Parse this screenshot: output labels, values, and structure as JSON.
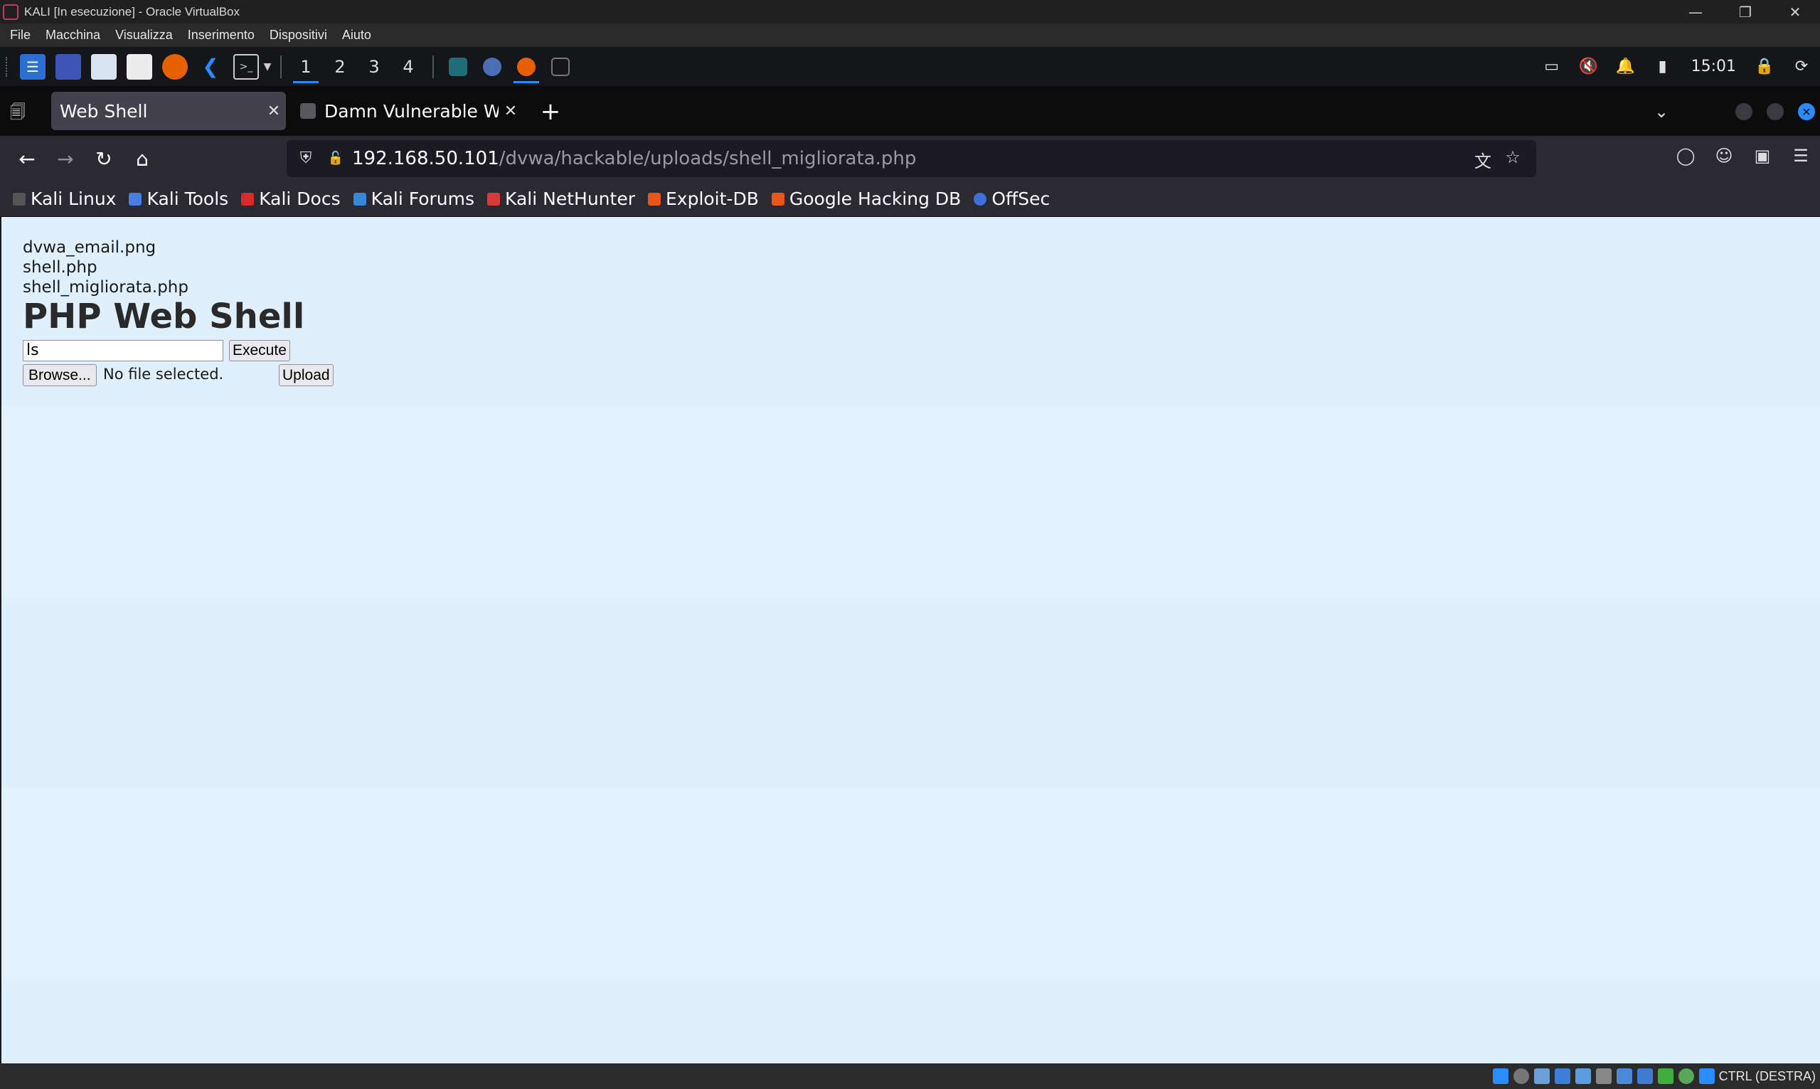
{
  "vbox": {
    "title": "KALI [In esecuzione] - Oracle VirtualBox",
    "menu": [
      "File",
      "Macchina",
      "Visualizza",
      "Inserimento",
      "Dispositivi",
      "Aiuto"
    ],
    "host_key": "CTRL (DESTRA)"
  },
  "panel": {
    "workspaces": [
      "1",
      "2",
      "3",
      "4"
    ],
    "clock": "15:01"
  },
  "browser": {
    "tabs": [
      {
        "label": "Web Shell",
        "active": true
      },
      {
        "label": "Damn Vulnerable Web",
        "active": false
      }
    ],
    "url_host": "192.168.50.101",
    "url_path": "/dvwa/hackable/uploads/shell_migliorata.php",
    "bookmarks": [
      "Kali Linux",
      "Kali Tools",
      "Kali Docs",
      "Kali Forums",
      "Kali NetHunter",
      "Exploit-DB",
      "Google Hacking DB",
      "OffSec"
    ]
  },
  "page": {
    "files": [
      "dvwa_email.png",
      "shell.php",
      "shell_migliorata.php"
    ],
    "title": "PHP Web Shell",
    "command_value": "ls",
    "execute_label": "Execute",
    "browse_label": "Browse...",
    "no_file_text": "No file selected.",
    "upload_label": "Upload"
  },
  "colors": {
    "page_background": "#e1f0fc",
    "accent": "#2a8cff"
  }
}
